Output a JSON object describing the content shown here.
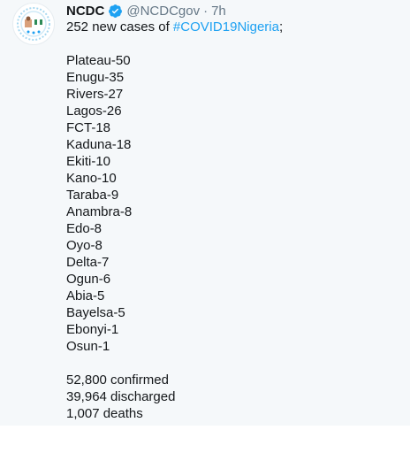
{
  "tweet": {
    "author_name": "NCDC",
    "handle": "@NCDCgov",
    "separator": "·",
    "time": "7h",
    "intro": "252 new cases of ",
    "hashtag": "#COVID19Nigeria",
    "intro_end": ";",
    "states": [
      "Plateau-50",
      "Enugu-35",
      "Rivers-27",
      "Lagos-26",
      "FCT-18",
      "Kaduna-18",
      "Ekiti-10",
      "Kano-10",
      "Taraba-9",
      "Anambra-8",
      "Edo-8",
      "Oyo-8",
      "Delta-7",
      "Ogun-6",
      "Abia-5",
      "Bayelsa-5",
      "Ebonyi-1",
      "Osun-1"
    ],
    "confirmed": "52,800 confirmed",
    "discharged": "39,964 discharged",
    "deaths": "1,007 deaths"
  },
  "icons": {
    "avatar": "ncdc-logo-avatar",
    "verified": "verified-badge-icon"
  },
  "colors": {
    "background": "#f5f8fa",
    "hashtag": "#1da1f2",
    "secondary_text": "#657786",
    "verified": "#1da1f2",
    "primary_text": "#14171a"
  }
}
